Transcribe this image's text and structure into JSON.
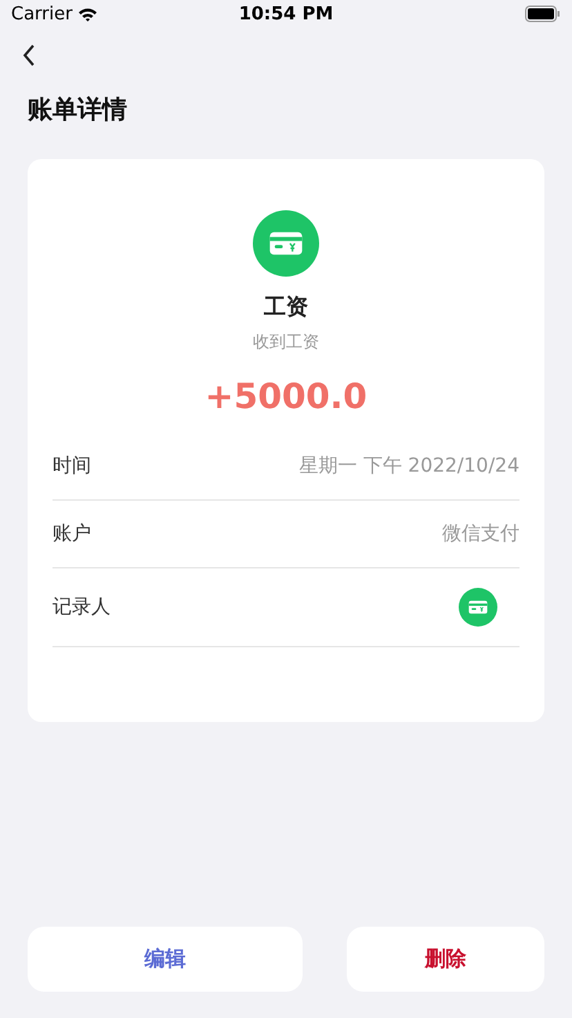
{
  "status_bar": {
    "carrier": "Carrier",
    "time": "10:54 PM"
  },
  "header": {
    "title": "账单详情"
  },
  "bill": {
    "category": "工资",
    "note": "收到工资",
    "amount": {
      "text": "+5000.0",
      "kind": "income"
    },
    "rows": [
      {
        "kind": "text",
        "label": "时间",
        "value": "星期一 下午 2022/10/24"
      },
      {
        "kind": "text",
        "label": "账户",
        "value": "微信支付"
      },
      {
        "kind": "icon",
        "label": "记录人"
      }
    ]
  },
  "actions": [
    {
      "label": "编辑",
      "kind": "edit"
    },
    {
      "label": "删除",
      "kind": "delete"
    }
  ]
}
